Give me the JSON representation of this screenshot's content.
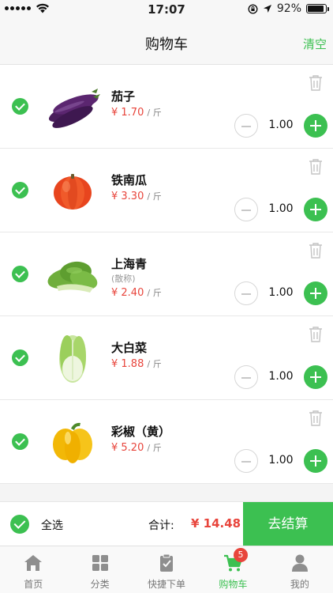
{
  "status_bar": {
    "time": "17:07",
    "battery": "92%"
  },
  "header": {
    "title": "购物车",
    "clear_label": "清空"
  },
  "items": [
    {
      "name": "茄子",
      "spec": "",
      "price": "¥ 1.70",
      "unit": "/ 斤",
      "qty": "1.00",
      "checked": true,
      "image": "eggplant"
    },
    {
      "name": "铁南瓜",
      "spec": "",
      "price": "¥ 3.30",
      "unit": "/ 斤",
      "qty": "1.00",
      "checked": true,
      "image": "pumpkin"
    },
    {
      "name": "上海青",
      "spec": "(散称)",
      "price": "¥ 2.40",
      "unit": "/ 斤",
      "qty": "1.00",
      "checked": true,
      "image": "bok-choy"
    },
    {
      "name": "大白菜",
      "spec": "",
      "price": "¥ 1.88",
      "unit": "/ 斤",
      "qty": "1.00",
      "checked": true,
      "image": "napa-cabbage"
    },
    {
      "name": "彩椒（黄）",
      "spec": "",
      "price": "¥ 5.20",
      "unit": "/ 斤",
      "qty": "1.00",
      "checked": true,
      "image": "yellow-pepper"
    }
  ],
  "checkout": {
    "select_all_label": "全选",
    "total_label": "合计:",
    "total_value": "¥ 14.48",
    "checkout_label": "去结算"
  },
  "tabs": [
    {
      "label": "首页",
      "icon": "home-icon"
    },
    {
      "label": "分类",
      "icon": "grid-icon"
    },
    {
      "label": "快捷下单",
      "icon": "clipboard-check-icon"
    },
    {
      "label": "购物车",
      "icon": "cart-icon",
      "active": true
    },
    {
      "label": "我的",
      "icon": "person-icon"
    }
  ],
  "cart_badge": "5",
  "colors": {
    "accent": "#3cc051",
    "price": "#e8453c"
  }
}
